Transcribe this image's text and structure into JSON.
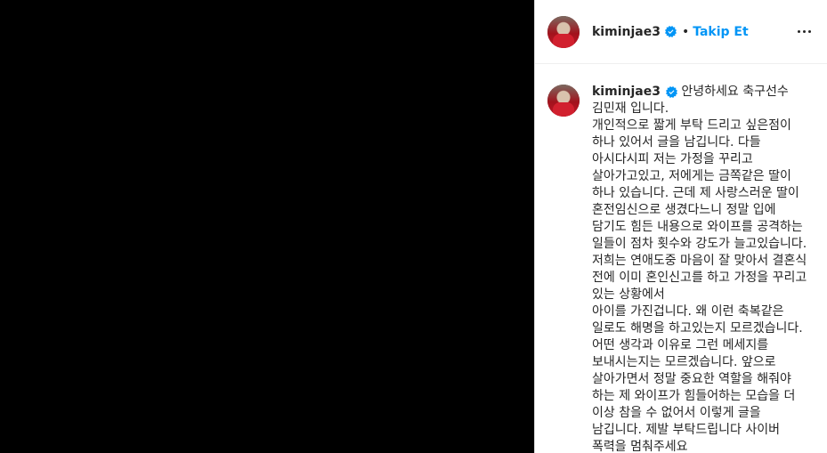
{
  "post": {
    "username": "kiminjae3",
    "dot": "•",
    "follow_label": "Takip Et",
    "verified_icon": "verified-badge-icon",
    "more_icon": "more-options-icon",
    "accent_color": "#0095f6"
  },
  "caption": {
    "username": "kiminjae3",
    "lines": [
      "안녕하세요 축구선수 김민재 입니다.",
      "개인적으로 짧게 부탁 드리고 싶은점이 하나 있어서 글을 남깁니다. 다들 아시다시피 저는 가정을 꾸리고 살아가고있고, 저에게는 금쪽같은 딸이 하나 있습니다. 근데 제 사랑스러운 딸이 혼전임신으로 생겼다느니 정말 입에 담기도 힘든 내용으로 와이프를 공격하는 일들이 점차 횟수와 강도가 늘고있습니다.",
      "저희는 연애도중 마음이 잘 맞아서 결혼식 전에 이미 혼인신고를 하고 가정을 꾸리고 있는 상황에서",
      "아이를 가진겁니다. 왜 이런 축복같은 일로도 해명을 하고있는지 모르겠습니다. 어떤 생각과 이유로 그런 메세지를 보내시는지는 모르겠습니다. 앞으로 살아가면서 정말 중요한 역할을 해줘야 하는 제 와이프가 힘들어하는 모습을 더 이상 참을 수 없어서 이렇게 글을 남깁니다. 제발 부탁드립니다 사이버 폭력을 멈춰주세요"
    ]
  }
}
